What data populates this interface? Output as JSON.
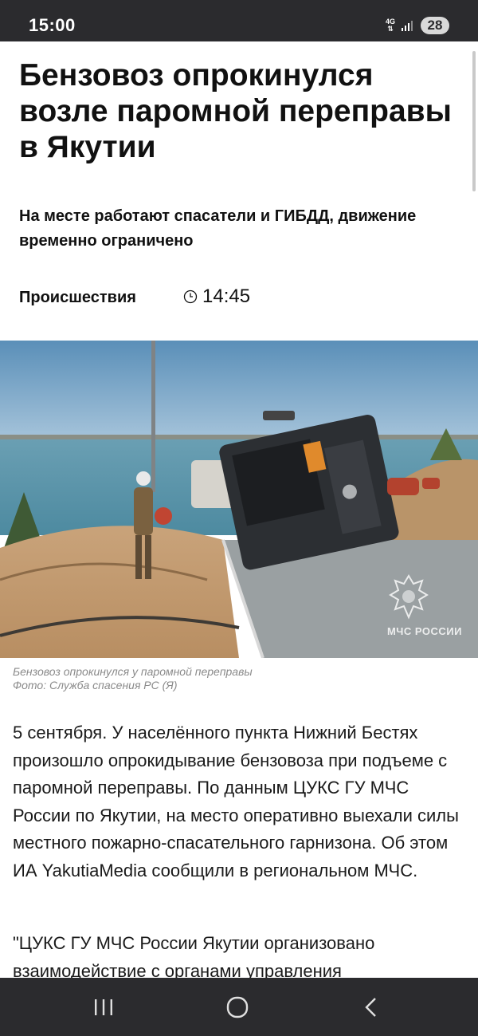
{
  "status_bar": {
    "time": "15:00",
    "network": "4G",
    "battery": "28",
    "icons": [
      "network-4g-icon",
      "signal-icon",
      "battery-icon"
    ]
  },
  "article": {
    "title": "Бензовоз опрокинулся возле паромной переправы в Якутии",
    "subtitle": "На месте работают спасатели и ГИБДД, движение временно ограничено",
    "category": "Происшествия",
    "time": "14:45",
    "photo": {
      "watermark": "МЧС РОССИИ",
      "caption_line1": "Бензовоз опрокинулся у паромной переправы",
      "caption_line2": "Фото: Служба спасения РС (Я)"
    },
    "paragraph1": "5 сентября. У населённого пункта Нижний Бестях произошло опрокидывание бензовоза при подъеме с паромной переправы. По данным ЦУКС ГУ МЧС России по Якутии, на место оперативно выехали силы местного пожарно-спасательного гарнизона. Об этом ИА YakutiaMedia сообщили в региональном МЧС.",
    "paragraph2": "\"ЦУКС ГУ МЧС России Якутии организовано взаимодействие с органами управления"
  },
  "nav_bar": {
    "icons": [
      "recents-icon",
      "home-icon",
      "back-icon"
    ]
  },
  "colors": {
    "system_bar": "#2b2b2e",
    "text": "#111111",
    "caption": "#8a8a8a"
  }
}
